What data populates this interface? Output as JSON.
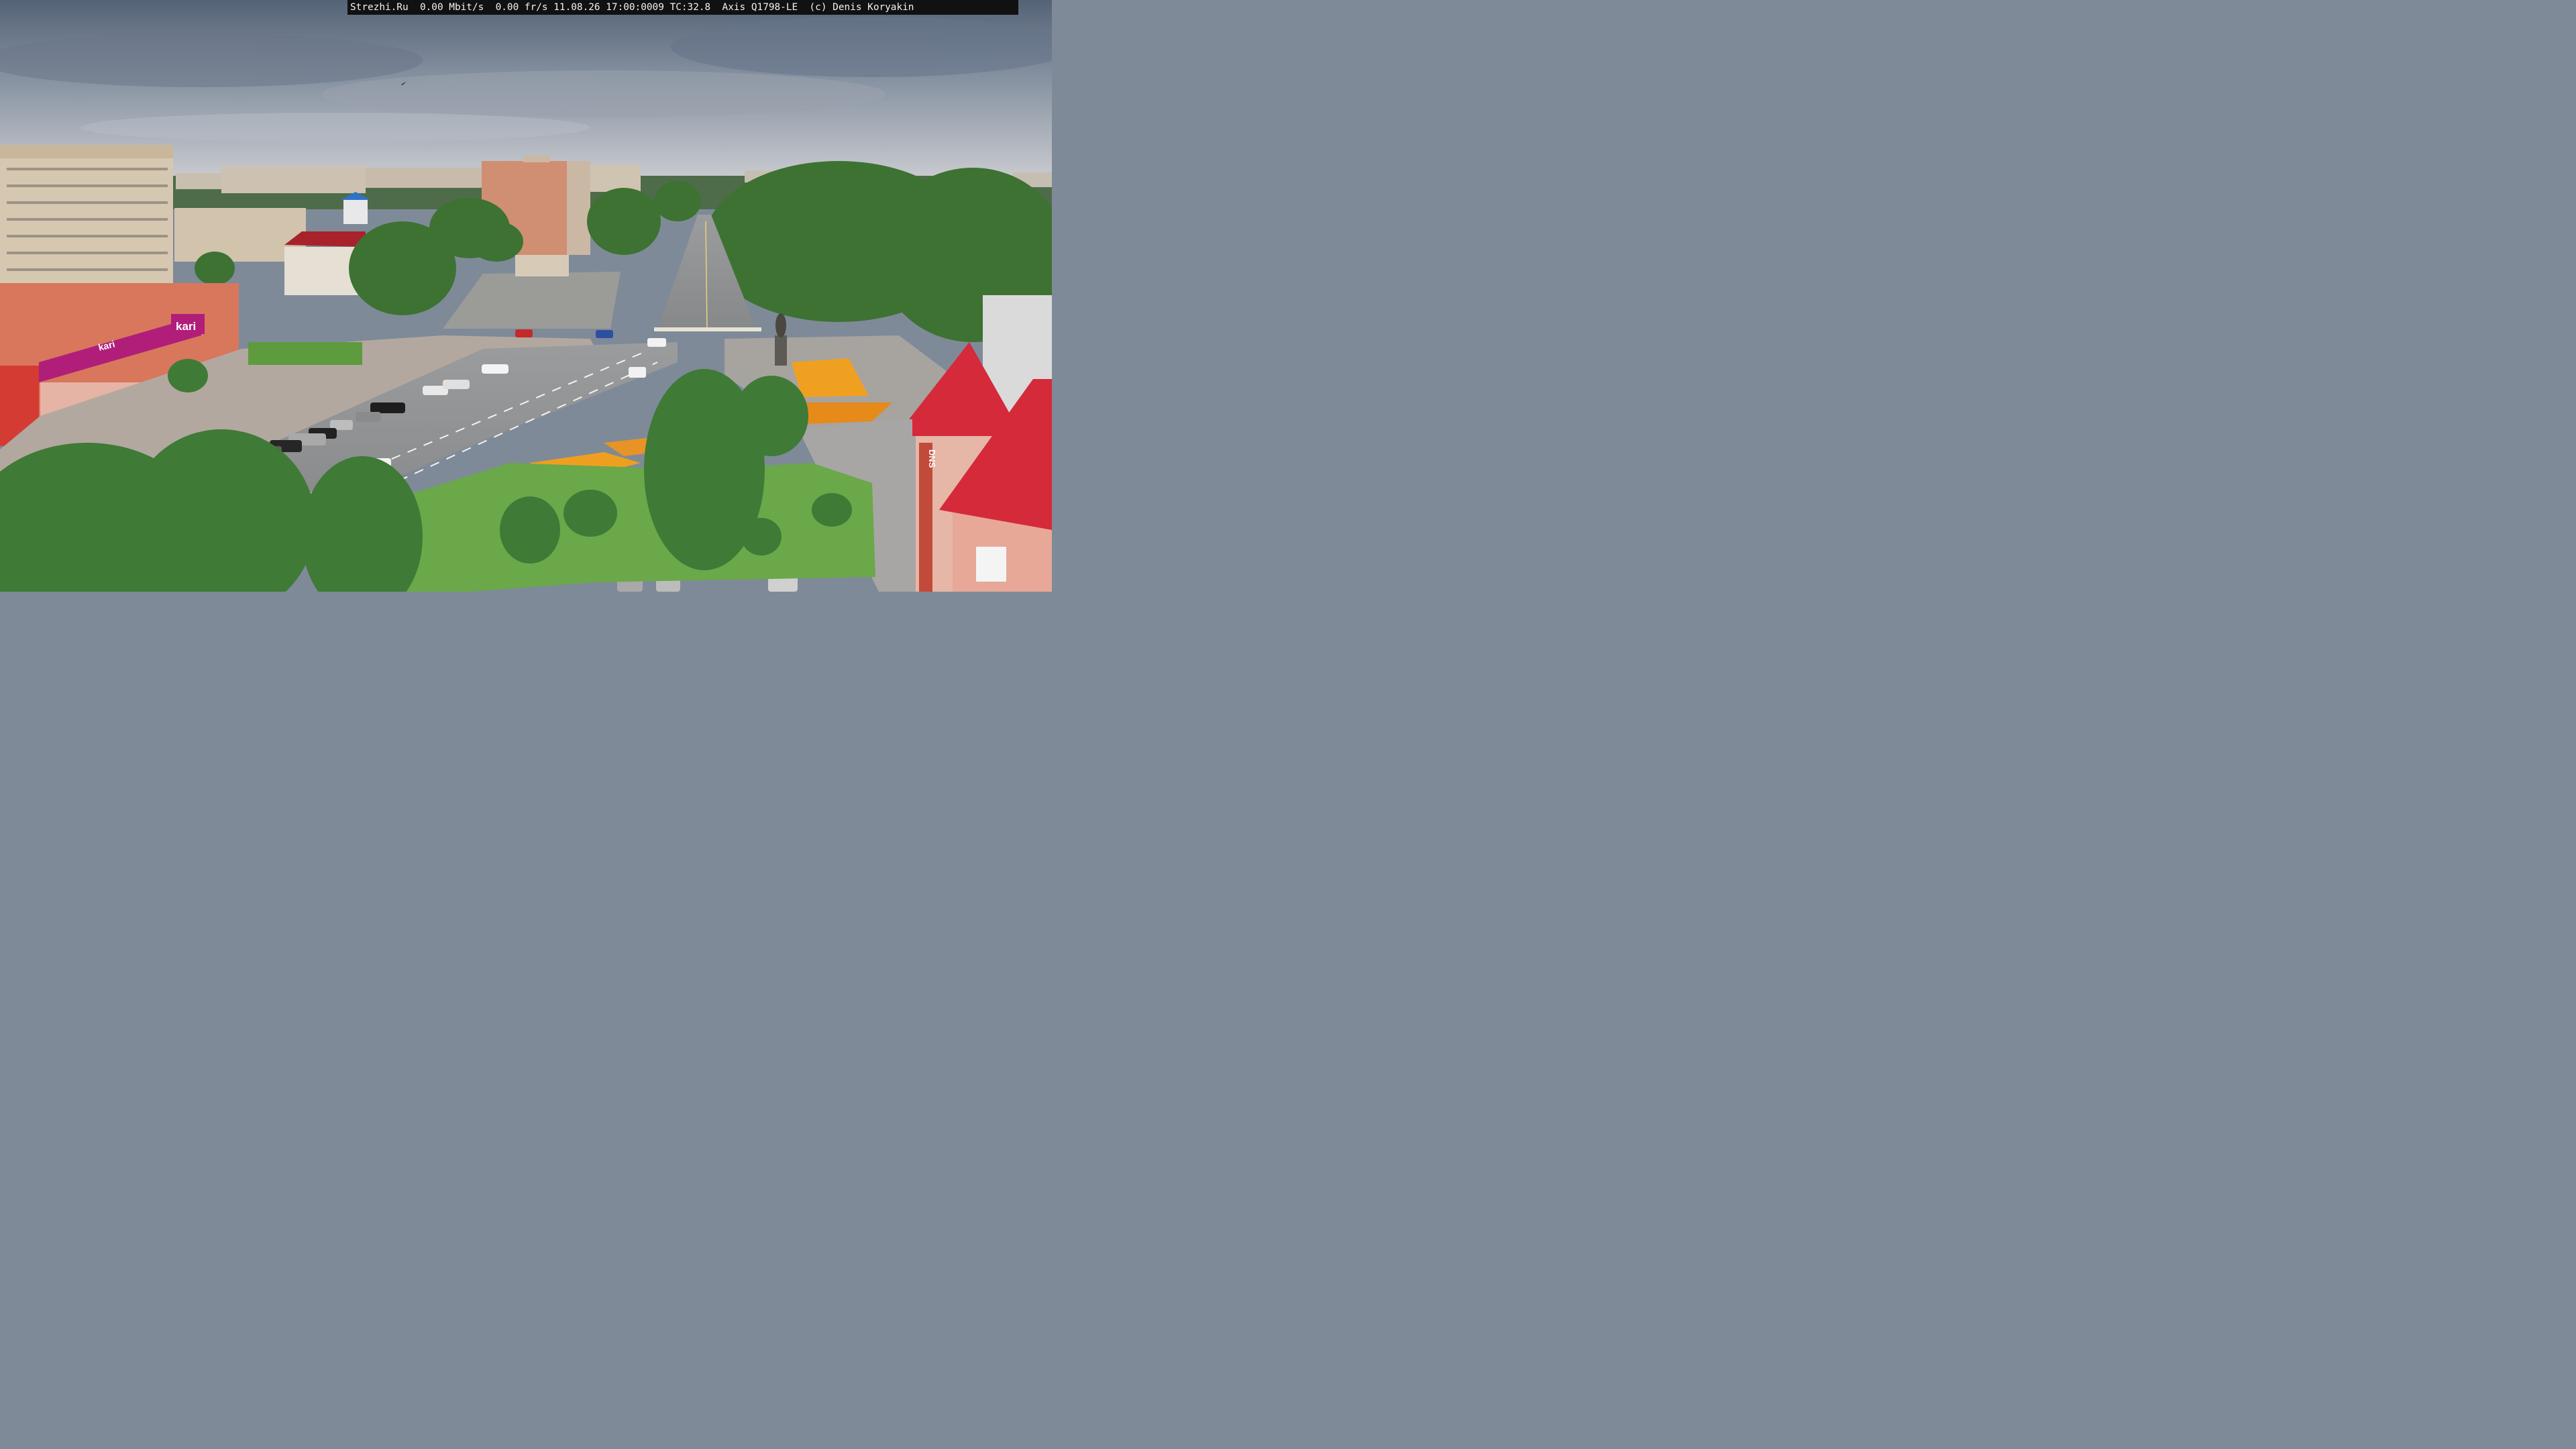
{
  "overlay": {
    "site": "Strezhi.Ru",
    "bitrate": "0.00 Mbit/s",
    "framerate": "0.00 fr/s",
    "datetime": "11.08.26 17:00:0009",
    "tc": "TC:32.8",
    "camera": "Axis Q1798-LE",
    "copyright": "(c) Denis Koryakin"
  },
  "signage": {
    "store_brand": "kari",
    "store_brand_upper": "kari",
    "dns_sign": "DNS"
  },
  "colors": {
    "sky_top": "#5f6c7e",
    "sky_bottom": "#c9ccd2",
    "building_beige": "#d6c7b0",
    "brick_orange": "#d8775c",
    "kari_magenta": "#b01e7a",
    "roof_red": "#d42a3a",
    "tree_green": "#3f7a36",
    "grass": "#6aa84a",
    "road": "#8f9193",
    "flower_orange": "#f0a020"
  }
}
